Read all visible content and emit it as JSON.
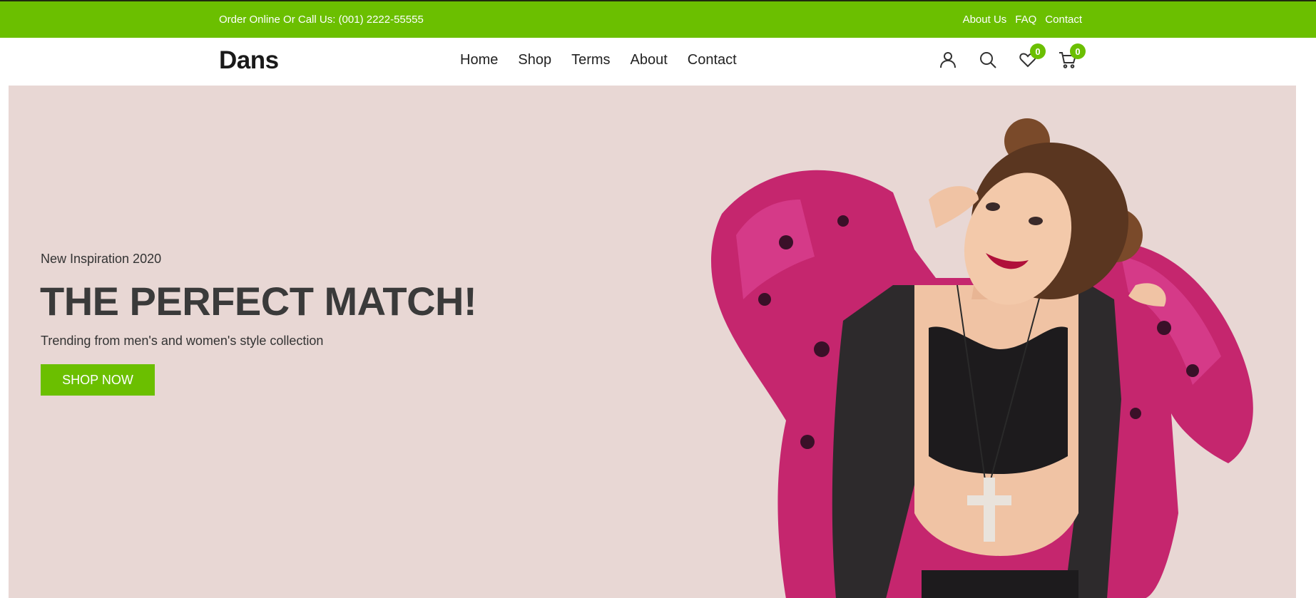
{
  "topbar": {
    "phone_text": "Order Online Or Call Us: (001) 2222-55555",
    "links": [
      "About Us",
      "FAQ",
      "Contact"
    ]
  },
  "header": {
    "logo": "Dans",
    "nav": [
      "Home",
      "Shop",
      "Terms",
      "About",
      "Contact"
    ],
    "icons": [
      "user-icon",
      "search-icon",
      "heart-icon",
      "cart-icon"
    ],
    "wishlist_count": "0",
    "cart_count": "0"
  },
  "hero": {
    "kicker": "New Inspiration 2020",
    "title": "THE PERFECT MATCH!",
    "subtitle": "Trending from men's and women's style collection",
    "button_label": "SHOP NOW"
  },
  "colors": {
    "accent": "#6bbf00",
    "hero_bg": "#e8d7d4",
    "text_dark": "#3a3a3a"
  }
}
